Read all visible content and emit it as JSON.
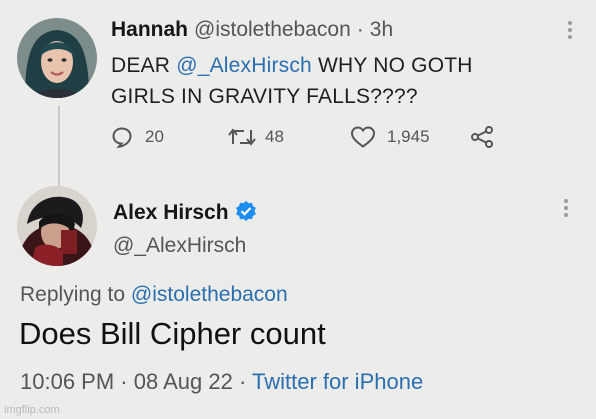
{
  "reply_tweet": {
    "author_name": "Hannah",
    "author_handle": "@istolethebacon",
    "separator": "·",
    "time_ago": "3h",
    "text_prefix": "DEAR ",
    "text_mention": "@_AlexHirsch",
    "text_line1_rest": " WHY NO GOTH",
    "text_line2": "GIRLS IN GRAVITY FALLS????",
    "replies": "20",
    "retweets": "48",
    "likes": "1,945"
  },
  "main_tweet": {
    "author_name": "Alex Hirsch",
    "author_handle": "@_AlexHirsch",
    "replying_label": "Replying to ",
    "replying_handle": "@istolethebacon",
    "text": "Does Bill Cipher count",
    "time": "10:06 PM",
    "dot1": " · ",
    "date": "08 Aug 22",
    "dot2": " · ",
    "source": "Twitter for iPhone"
  },
  "watermark": "imgflip.com",
  "colors": {
    "link": "#2a6fb0",
    "verified": "#1d8ef0",
    "background": "#ececea"
  },
  "icons": [
    "reply-icon",
    "retweet-icon",
    "like-icon",
    "share-icon",
    "more-icon",
    "verified-icon"
  ]
}
